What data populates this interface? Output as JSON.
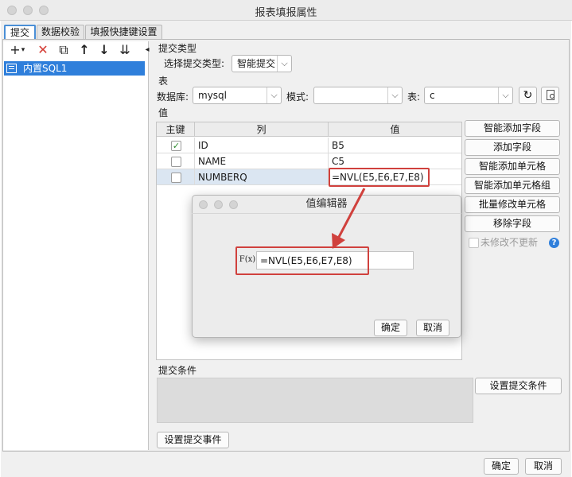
{
  "window": {
    "title": "报表填报属性"
  },
  "tabs": [
    {
      "label": "提交",
      "active": true
    },
    {
      "label": "数据校验",
      "active": false
    },
    {
      "label": "填报快捷键设置",
      "active": false
    }
  ],
  "left_toolbar": {
    "add": "+",
    "add_menu": "▾",
    "delete": "✕",
    "copy": "⧉",
    "move_up": "↑",
    "move_down": "↓",
    "sort": "⇊",
    "collapse": "◂"
  },
  "tree": {
    "items": [
      "内置SQL1"
    ]
  },
  "submit_type": {
    "section": "提交类型",
    "label": "选择提交类型:",
    "value": "智能提交"
  },
  "table_section": {
    "section": "表",
    "db_label": "数据库:",
    "db_value": "mysql",
    "schema_label": "模式:",
    "schema_value": "",
    "table_label": "表:",
    "table_value": "c"
  },
  "values_section": {
    "section": "值",
    "headers": [
      "主键",
      "列",
      "值"
    ],
    "rows": [
      {
        "key": true,
        "column": "ID",
        "value": "B5"
      },
      {
        "key": false,
        "column": "NAME",
        "value": "C5"
      },
      {
        "key": false,
        "column": "NUMBERQ",
        "value": "=NVL(E5,E6,E7,E8)"
      }
    ]
  },
  "side_buttons": [
    "智能添加字段",
    "添加字段",
    "智能添加单元格",
    "智能添加单元格组",
    "批量修改单元格",
    "移除字段"
  ],
  "no_update_label": "未修改不更新",
  "help_icon": "?",
  "dialog": {
    "title": "值编辑器",
    "formula_icon": "F(x)",
    "value": "=NVL(E5,E6,E7,E8)",
    "ok": "确定",
    "cancel": "取消"
  },
  "submit_condition": {
    "section": "提交条件",
    "button": "设置提交条件"
  },
  "event_button": "设置提交事件",
  "footer": {
    "ok": "确定",
    "cancel": "取消"
  },
  "colors": {
    "accent": "#2f7fdb",
    "highlight_red": "#d0413d",
    "selected_row": "#dbe6f2"
  }
}
